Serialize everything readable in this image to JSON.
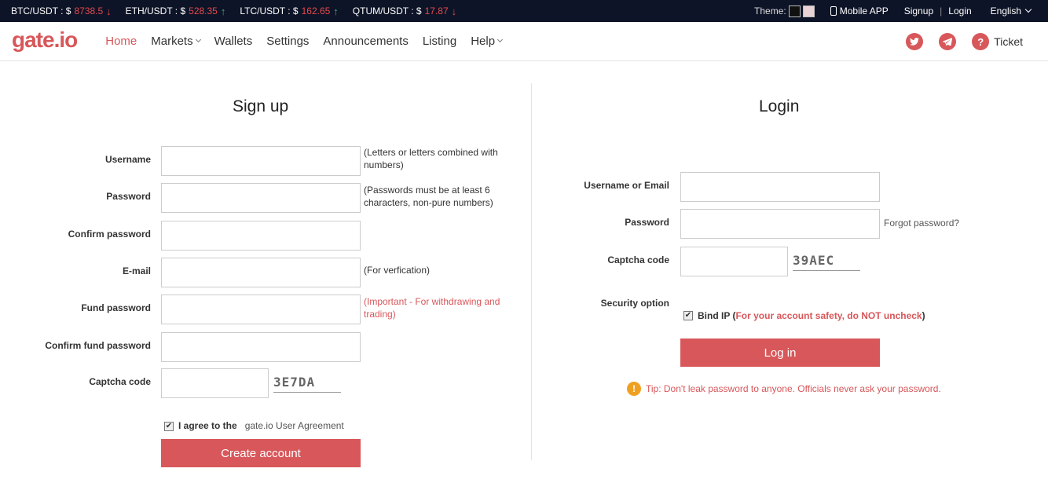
{
  "ticker": [
    {
      "pair": "BTC/USDT : $",
      "price": "8738.5",
      "arrow": "↓",
      "dir": "down"
    },
    {
      "pair": "ETH/USDT : $",
      "price": "528.35",
      "arrow": "↑",
      "dir": "up"
    },
    {
      "pair": "LTC/USDT : $",
      "price": "162.65",
      "arrow": "↑",
      "dir": "up"
    },
    {
      "pair": "QTUM/USDT : $",
      "price": "17.87",
      "arrow": "↓",
      "dir": "down"
    }
  ],
  "topbar": {
    "theme_label": "Theme:",
    "mobile_app": "Mobile APP",
    "signup": "Signup",
    "separator": "|",
    "login": "Login",
    "language": "English"
  },
  "nav": {
    "logo": "gate.io",
    "items": [
      "Home",
      "Markets",
      "Wallets",
      "Settings",
      "Announcements",
      "Listing",
      "Help"
    ],
    "ticket": "Ticket"
  },
  "signup": {
    "title": "Sign up",
    "username_label": "Username",
    "username_hint": "(Letters or letters combined with numbers)",
    "password_label": "Password",
    "password_hint": "(Passwords must be at least 6 characters, non-pure numbers)",
    "confirm_password_label": "Confirm password",
    "email_label": "E-mail",
    "email_hint": "(For verfication)",
    "fund_password_label": "Fund password",
    "fund_password_hint": "(Important - For withdrawing and trading)",
    "confirm_fund_password_label": "Confirm fund password",
    "captcha_label": "Captcha code",
    "captcha_text": "3E7DA",
    "agree_text": "I agree to the",
    "agreement_link": "gate.io User Agreement",
    "create_button": "Create account"
  },
  "login": {
    "title": "Login",
    "username_label": "Username or Email",
    "password_label": "Password",
    "forgot": "Forgot password?",
    "captcha_label": "Captcha code",
    "captcha_text": "39AEC",
    "security_label": "Security option",
    "bind_ip": "Bind IP (",
    "bind_warning": "For your account safety, do NOT uncheck",
    "bind_close": ")",
    "login_button": "Log in",
    "tip": "Tip: Don't leak password to anyone. Officials never ask your password."
  },
  "colors": {
    "accent": "#d8575a",
    "topbar": "#0e1427",
    "tip_icon": "#f0a020"
  }
}
